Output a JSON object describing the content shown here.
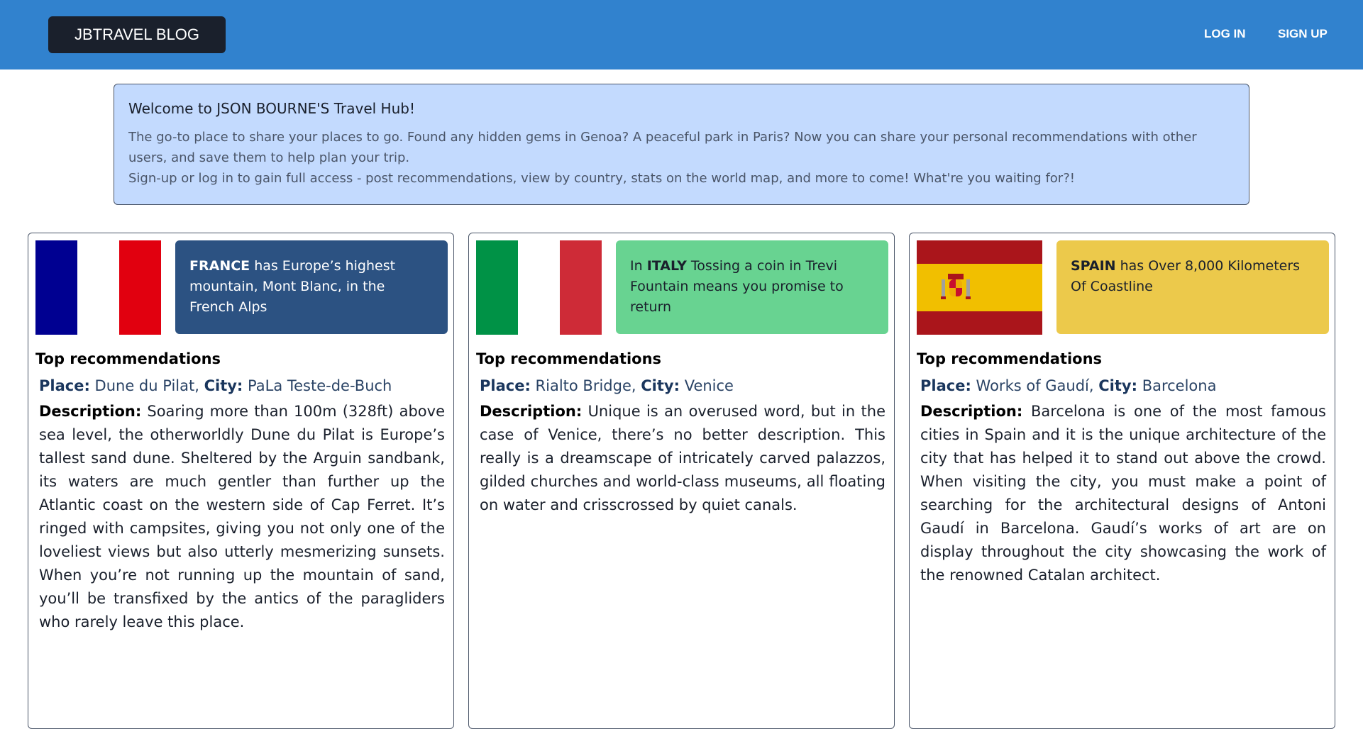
{
  "nav": {
    "brand": "JBTRAVEL BLOG",
    "login": "LOG IN",
    "signup": "SIGN UP"
  },
  "welcome": {
    "title": "Welcome to JSON BOURNE'S Travel Hub!",
    "line1": "The go-to place to share your places to go. Found any hidden gems in Genoa? A peaceful park in Paris? Now you can share your personal recommendations with other users, and save them to help plan your trip.",
    "line2": "Sign-up or log in to gain full access - post recommendations, view by country, stats on the world map, and more to come! What're you waiting for?!"
  },
  "cards": [
    {
      "country": "FRANCE",
      "fact": "has Europe’s highest mountain, Mont Blanc, in the French Alps",
      "flag_colors": [
        "#000091",
        "#ffffff",
        "#e1000f"
      ],
      "top_label": "Top recommendations",
      "place_label": "Place:",
      "place": "Dune du Pilat,",
      "city_label": "City:",
      "city": "PaLa Teste-de-Buch",
      "desc_label": "Description:",
      "description": "Soaring more than 100m (328ft) above sea level, the otherworldly Dune du Pilat is Europe’s tallest sand dune. Sheltered by the Arguin sandbank, its waters are much gentler than further up the Atlantic coast on the western side of Cap Ferret. It’s ringed with campsites, giving you not only one of the loveliest views but also utterly mesmerizing sunsets. When you’re not running up the mountain of sand, you’ll be transfixed by the antics of the paragliders who rarely leave this place."
    },
    {
      "country_prefix": "In",
      "country": "ITALY",
      "fact": "Tossing a coin in Trevi Fountain means you promise to return",
      "flag_colors": [
        "#009246",
        "#ffffff",
        "#ce2b37"
      ],
      "top_label": "Top recommendations",
      "place_label": "Place:",
      "place": "Rialto Bridge,",
      "city_label": "City:",
      "city": "Venice",
      "desc_label": "Description:",
      "description": "Unique is an overused word, but in the case of Venice, there’s no better description. This really is a dreamscape of intricately carved palazzos, gilded churches and world-class museums, all floating on water and crisscrossed by quiet canals."
    },
    {
      "country": "SPAIN",
      "fact": "has Over 8,000 Kilometers Of Coastline",
      "flag_colors": [
        "#aa151b",
        "#f1bf00"
      ],
      "top_label": "Top recommendations",
      "place_label": "Place:",
      "place": "Works of Gaudí,",
      "city_label": "City:",
      "city": "Barcelona",
      "desc_label": "Description:",
      "description": "Barcelona is one of the most famous cities in Spain and it is the unique architecture of the city that has helped it to stand out above the crowd. When visiting the city, you must make a point of searching for the architectural designs of Antoni Gaudí in Barcelona. Gaudí’s works of art are on display throughout the city showcasing the work of the renowned Catalan architect."
    }
  ]
}
